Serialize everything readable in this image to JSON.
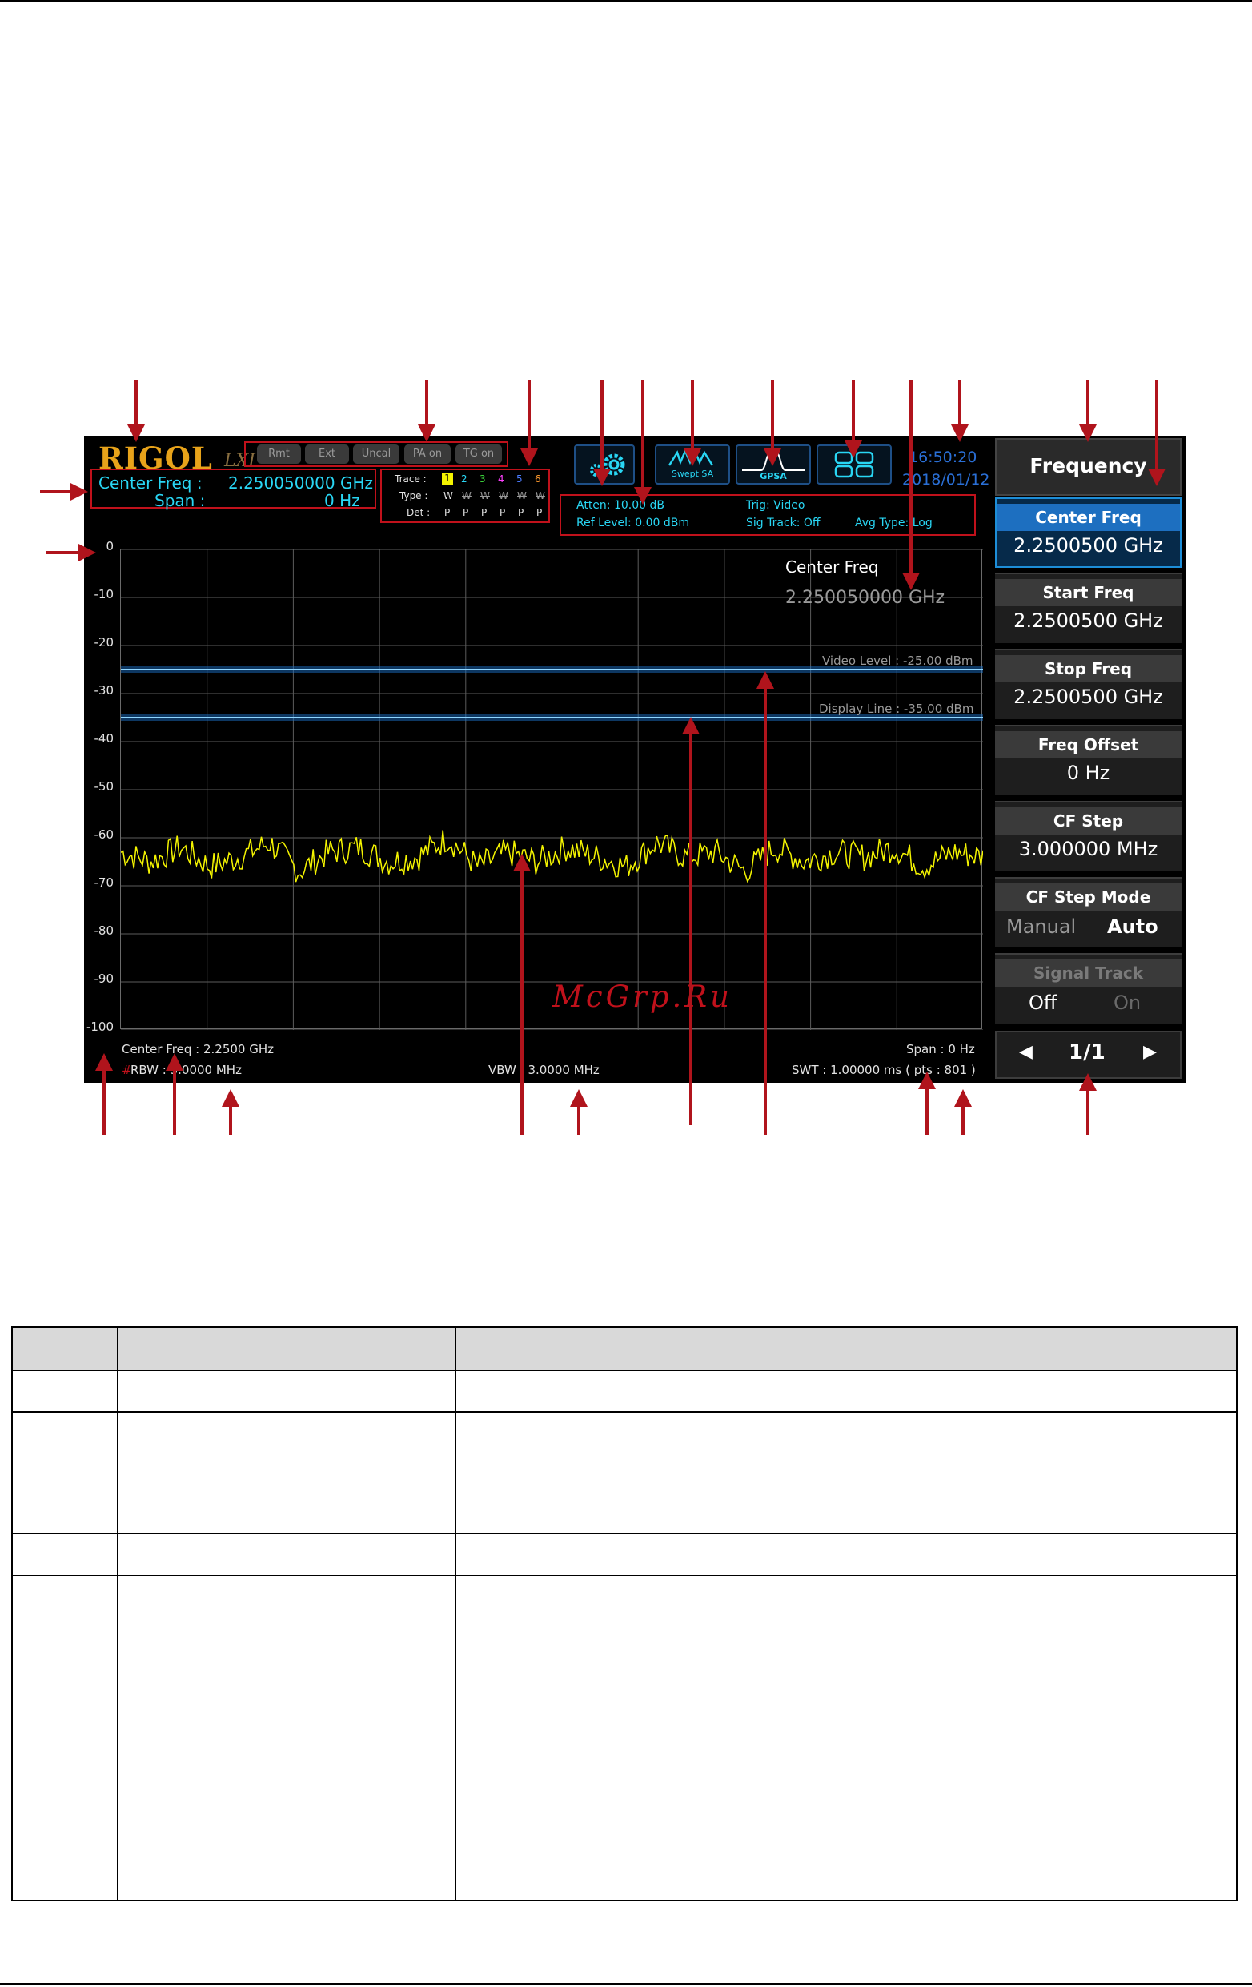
{
  "screen": {
    "logo": "RIGOL",
    "logo_sub": "LXI",
    "status_buttons": [
      "Rmt",
      "Ext",
      "Uncal",
      "PA on",
      "TG on"
    ],
    "center_freq_label": "Center Freq :",
    "center_freq_value": "2.250050000 GHz",
    "span_label": "Span :",
    "span_value": "0 Hz",
    "trace": {
      "trace_label": "Trace :",
      "trace_numbers": [
        "1",
        "2",
        "3",
        "4",
        "5",
        "6"
      ],
      "type_label": "Type :",
      "type_values": [
        "W",
        "W",
        "W",
        "W",
        "W",
        "W"
      ],
      "det_label": "Det :",
      "det_values": [
        "P",
        "P",
        "P",
        "P",
        "P",
        "P"
      ]
    },
    "icons": {
      "swept_sa": "Swept SA",
      "gpsa": "GPSA"
    },
    "time": "16:50:20",
    "date": "2018/01/12",
    "params": {
      "atten": "Atten: 10.00 dB",
      "trig": "Trig: Video",
      "ref_level": "Ref Level: 0.00 dBm",
      "sig_track": "Sig Track: Off",
      "avg_type": "Avg Type: Log"
    },
    "y_axis": [
      "0",
      "-10",
      "-20",
      "-30",
      "-40",
      "-50",
      "-60",
      "-70",
      "-80",
      "-90",
      "-100"
    ],
    "marker": {
      "title": "Center Freq",
      "value": "2.250050000 GHz"
    },
    "video_level": "Video Level : -25.00 dBm",
    "display_line": "Display Line : -35.00 dBm",
    "bottom": {
      "center_freq": "Center Freq : 2.2500 GHz",
      "rbw_hash": "#",
      "rbw": "RBW : 3.0000 MHz",
      "vbw": "VBW : 3.0000 MHz",
      "span": "Span : 0 Hz",
      "swt": "SWT : 1.00000 ms ( pts : 801 )"
    },
    "menu": {
      "title": "Frequency",
      "items": [
        {
          "label": "Center Freq",
          "value": "2.2500500 GHz",
          "active": true
        },
        {
          "label": "Start Freq",
          "value": "2.2500500 GHz"
        },
        {
          "label": "Stop Freq",
          "value": "2.2500500 GHz"
        },
        {
          "label": "Freq Offset",
          "value": "0 Hz"
        },
        {
          "label": "CF Step",
          "value": "3.000000 MHz"
        }
      ],
      "cf_step_mode": {
        "label": "CF Step Mode",
        "manual": "Manual",
        "auto": "Auto"
      },
      "signal_track": {
        "label": "Signal Track",
        "off": "Off",
        "on": "On"
      },
      "page": "1/1"
    },
    "watermark": "McGrp.Ru",
    "colors": {
      "accent": "#29d6f4",
      "trace": "#f4f400",
      "annotation": "#c0111b",
      "logo": "#e8a31a"
    }
  },
  "chart_data": {
    "type": "line",
    "title": "",
    "xlabel": "",
    "ylabel": "",
    "ylim": [
      -100,
      0
    ],
    "y_ticks": [
      0,
      -10,
      -20,
      -30,
      -40,
      -50,
      -60,
      -70,
      -80,
      -90,
      -100
    ],
    "series": [
      {
        "values": [
          -63,
          -65,
          -62,
          -66,
          -64,
          -61,
          -67,
          -63,
          -62,
          -65,
          -64,
          -60,
          -66,
          -63,
          -65,
          -62,
          -64,
          -66,
          -61,
          -64,
          -63,
          -67,
          -62,
          -65,
          -63,
          -64,
          -62,
          -66,
          -63,
          -64
        ]
      }
    ],
    "reference_lines": [
      {
        "label": "Video Level : -25.00 dBm",
        "value": -25
      },
      {
        "label": "Display Line : -35.00 dBm",
        "value": -35
      }
    ],
    "grid": true
  }
}
